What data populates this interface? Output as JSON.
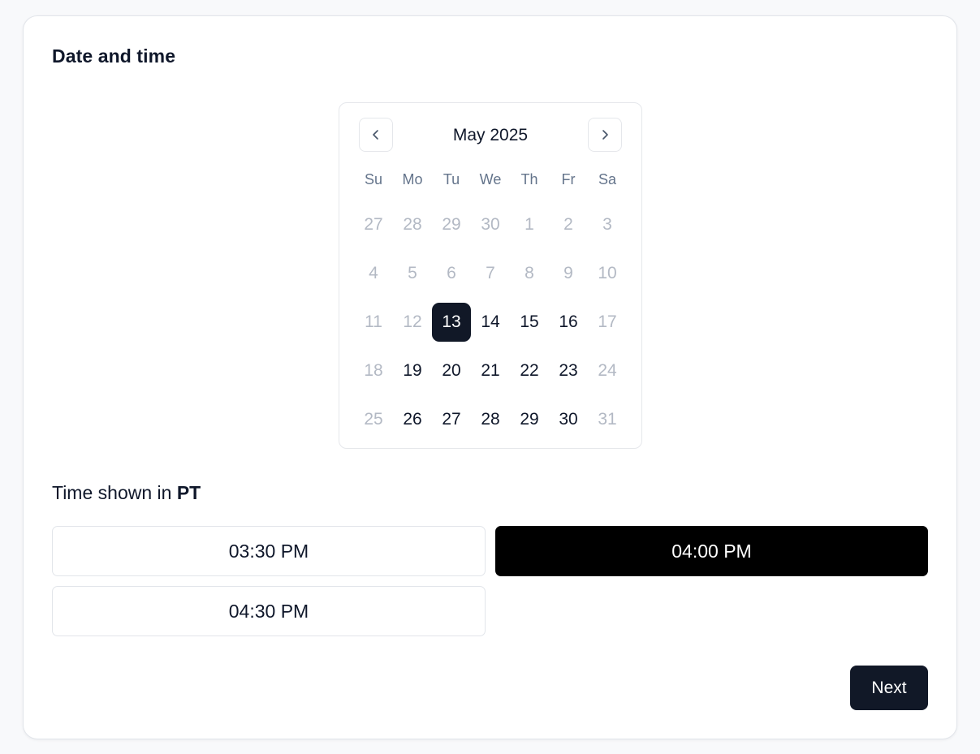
{
  "card": {
    "title": "Date and time"
  },
  "calendar": {
    "month_label": "May 2025",
    "prev_icon": "chevron-left-icon",
    "next_icon": "chevron-right-icon",
    "weekdays": [
      "Su",
      "Mo",
      "Tu",
      "We",
      "Th",
      "Fr",
      "Sa"
    ],
    "days": [
      {
        "label": "27",
        "state": "muted"
      },
      {
        "label": "28",
        "state": "muted"
      },
      {
        "label": "29",
        "state": "muted"
      },
      {
        "label": "30",
        "state": "muted"
      },
      {
        "label": "1",
        "state": "muted"
      },
      {
        "label": "2",
        "state": "muted"
      },
      {
        "label": "3",
        "state": "muted"
      },
      {
        "label": "4",
        "state": "muted"
      },
      {
        "label": "5",
        "state": "muted"
      },
      {
        "label": "6",
        "state": "muted"
      },
      {
        "label": "7",
        "state": "muted"
      },
      {
        "label": "8",
        "state": "muted"
      },
      {
        "label": "9",
        "state": "muted"
      },
      {
        "label": "10",
        "state": "muted"
      },
      {
        "label": "11",
        "state": "muted"
      },
      {
        "label": "12",
        "state": "muted"
      },
      {
        "label": "13",
        "state": "selected"
      },
      {
        "label": "14",
        "state": "active"
      },
      {
        "label": "15",
        "state": "active"
      },
      {
        "label": "16",
        "state": "active"
      },
      {
        "label": "17",
        "state": "muted"
      },
      {
        "label": "18",
        "state": "muted"
      },
      {
        "label": "19",
        "state": "active"
      },
      {
        "label": "20",
        "state": "active"
      },
      {
        "label": "21",
        "state": "active"
      },
      {
        "label": "22",
        "state": "active"
      },
      {
        "label": "23",
        "state": "active"
      },
      {
        "label": "24",
        "state": "muted"
      },
      {
        "label": "25",
        "state": "muted"
      },
      {
        "label": "26",
        "state": "active"
      },
      {
        "label": "27",
        "state": "active"
      },
      {
        "label": "28",
        "state": "active"
      },
      {
        "label": "29",
        "state": "active"
      },
      {
        "label": "30",
        "state": "active"
      },
      {
        "label": "31",
        "state": "muted"
      }
    ]
  },
  "timezone": {
    "prefix": "Time shown in ",
    "zone": "PT"
  },
  "slots": [
    {
      "label": "03:30 PM",
      "selected": false
    },
    {
      "label": "04:00 PM",
      "selected": true
    },
    {
      "label": "04:30 PM",
      "selected": false
    }
  ],
  "actions": {
    "next_label": "Next"
  },
  "colors": {
    "primary": "#111827",
    "selected_slot": "#000000",
    "muted_text": "#b3b9c4",
    "weekday_text": "#64748b",
    "border": "#e2e5ea"
  }
}
